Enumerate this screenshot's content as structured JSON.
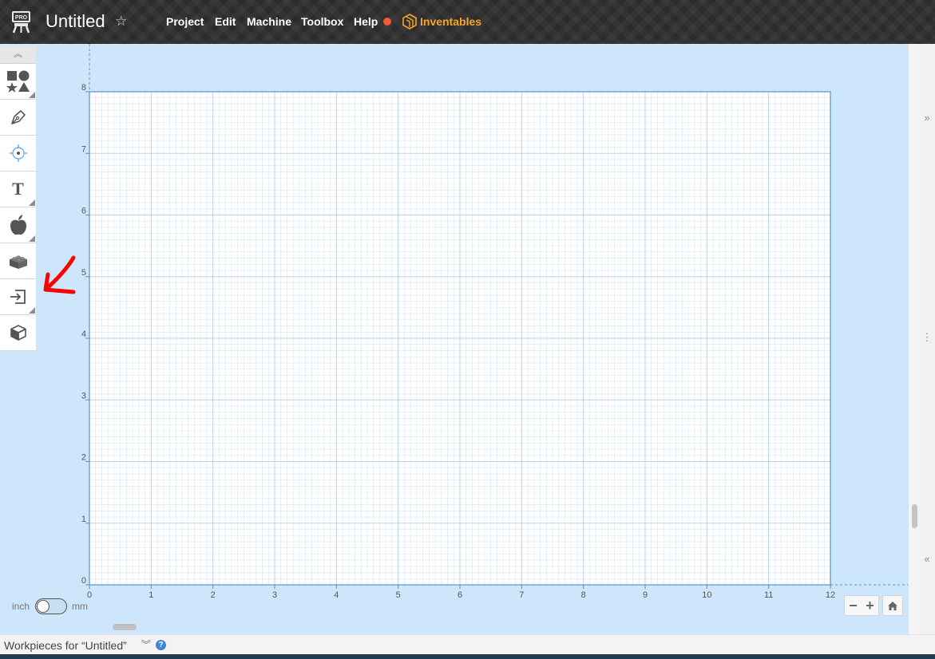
{
  "app": {
    "badge": "PRO",
    "title": "Untitled",
    "favorite_icon": "star-outline-icon"
  },
  "menu": [
    {
      "label": "Project"
    },
    {
      "label": "Edit"
    },
    {
      "label": "Machine"
    },
    {
      "label": "Toolbox"
    },
    {
      "label": "Help"
    }
  ],
  "status": {
    "indicator_color": "#ef5a3a"
  },
  "brand": {
    "label": "Inventables",
    "color": "#f5a623"
  },
  "toolbar": {
    "collapse_icon": "double-chevron-up-icon",
    "tools": [
      {
        "name": "shapes",
        "icon": "shapes-icon"
      },
      {
        "name": "pen",
        "icon": "pen-icon"
      },
      {
        "name": "point",
        "icon": "point-target-icon"
      },
      {
        "name": "text",
        "icon": "text-icon",
        "glyph": "T"
      },
      {
        "name": "icon-library",
        "icon": "apple-icon"
      },
      {
        "name": "apps",
        "icon": "lego-brick-icon"
      },
      {
        "name": "import",
        "icon": "import-icon"
      },
      {
        "name": "3d",
        "icon": "cube-icon"
      }
    ]
  },
  "canvas": {
    "unit": "inch",
    "x_ticks": [
      "0",
      "1",
      "2",
      "3",
      "4",
      "5",
      "6",
      "7",
      "8",
      "9",
      "10",
      "11",
      "12"
    ],
    "y_ticks": [
      "0",
      "1",
      "2",
      "3",
      "4",
      "5",
      "6",
      "7",
      "8"
    ],
    "workpiece_width": 12,
    "workpiece_height": 8,
    "background_color": "#cde6fb",
    "grid_color": "#d6e6f5",
    "axis_color": "#5b8fcf"
  },
  "units_toggle": {
    "left": "inch",
    "right": "mm",
    "selected": "inch"
  },
  "zoom": {
    "out_label": "−",
    "in_label": "+",
    "home_icon": "home-icon"
  },
  "right_panel": {
    "expand_icon": "double-chevron-right-icon",
    "handle_icon": "vertical-dots-icon",
    "collapse_icon": "double-chevron-left-icon"
  },
  "bottom": {
    "workpieces_label": "Workpieces for “Untitled”",
    "chevron": "»",
    "help_glyph": "?"
  },
  "annotation": {
    "color": "#ff0000",
    "icon": "red-arrow-annotation"
  }
}
